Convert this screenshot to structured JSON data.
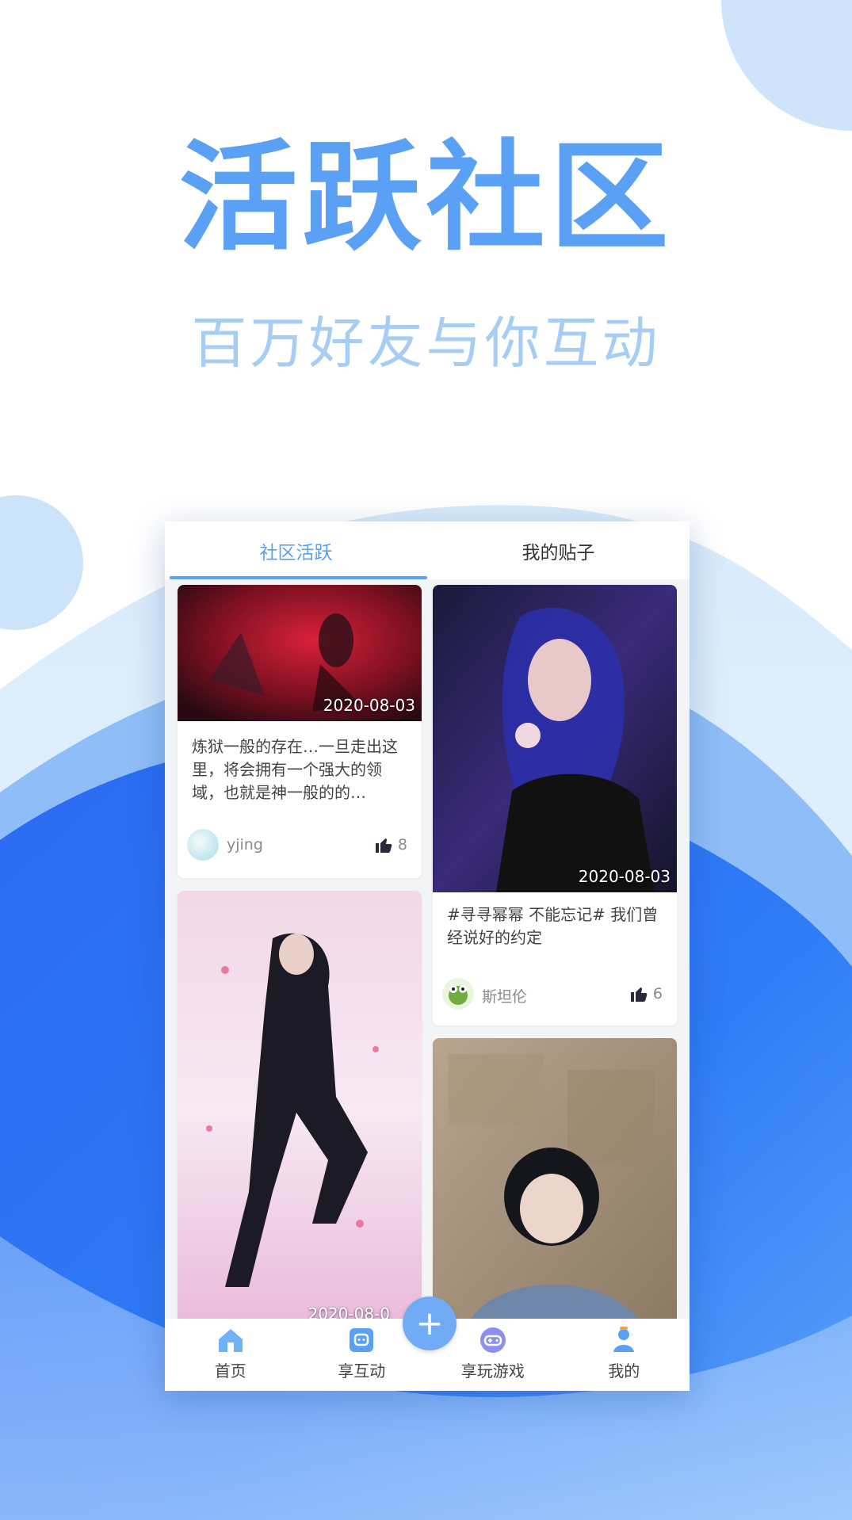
{
  "hero": {
    "title": "活跃社区",
    "subtitle": "百万好友与你互动"
  },
  "tabs": [
    {
      "label": "社区活跃",
      "active": true
    },
    {
      "label": "我的贴子",
      "active": false
    }
  ],
  "posts": [
    {
      "date": "2020-08-03",
      "text": "炼狱一般的存在…一旦走出这里，将会拥有一个强大的领域，也就是神一般的的…",
      "user": "yjing",
      "likes": "8"
    },
    {
      "date": "2020-08-03",
      "text": "#寻寻幂幂 不能忘记# 我们曾经说好的约定",
      "user": "斯坦伦",
      "likes": "6"
    },
    {
      "date": "2020-08-0"
    },
    {
      "date": ""
    }
  ],
  "nav": [
    {
      "label": "首页",
      "icon": "home-icon"
    },
    {
      "label": "享互动",
      "icon": "chat-icon"
    },
    {
      "label": "享玩游戏",
      "icon": "gamepad-icon"
    },
    {
      "label": "我的",
      "icon": "user-icon"
    }
  ],
  "fab": {
    "label": "+"
  },
  "colors": {
    "accent": "#5aa0f4",
    "bg_blue": "#2b74f0"
  }
}
